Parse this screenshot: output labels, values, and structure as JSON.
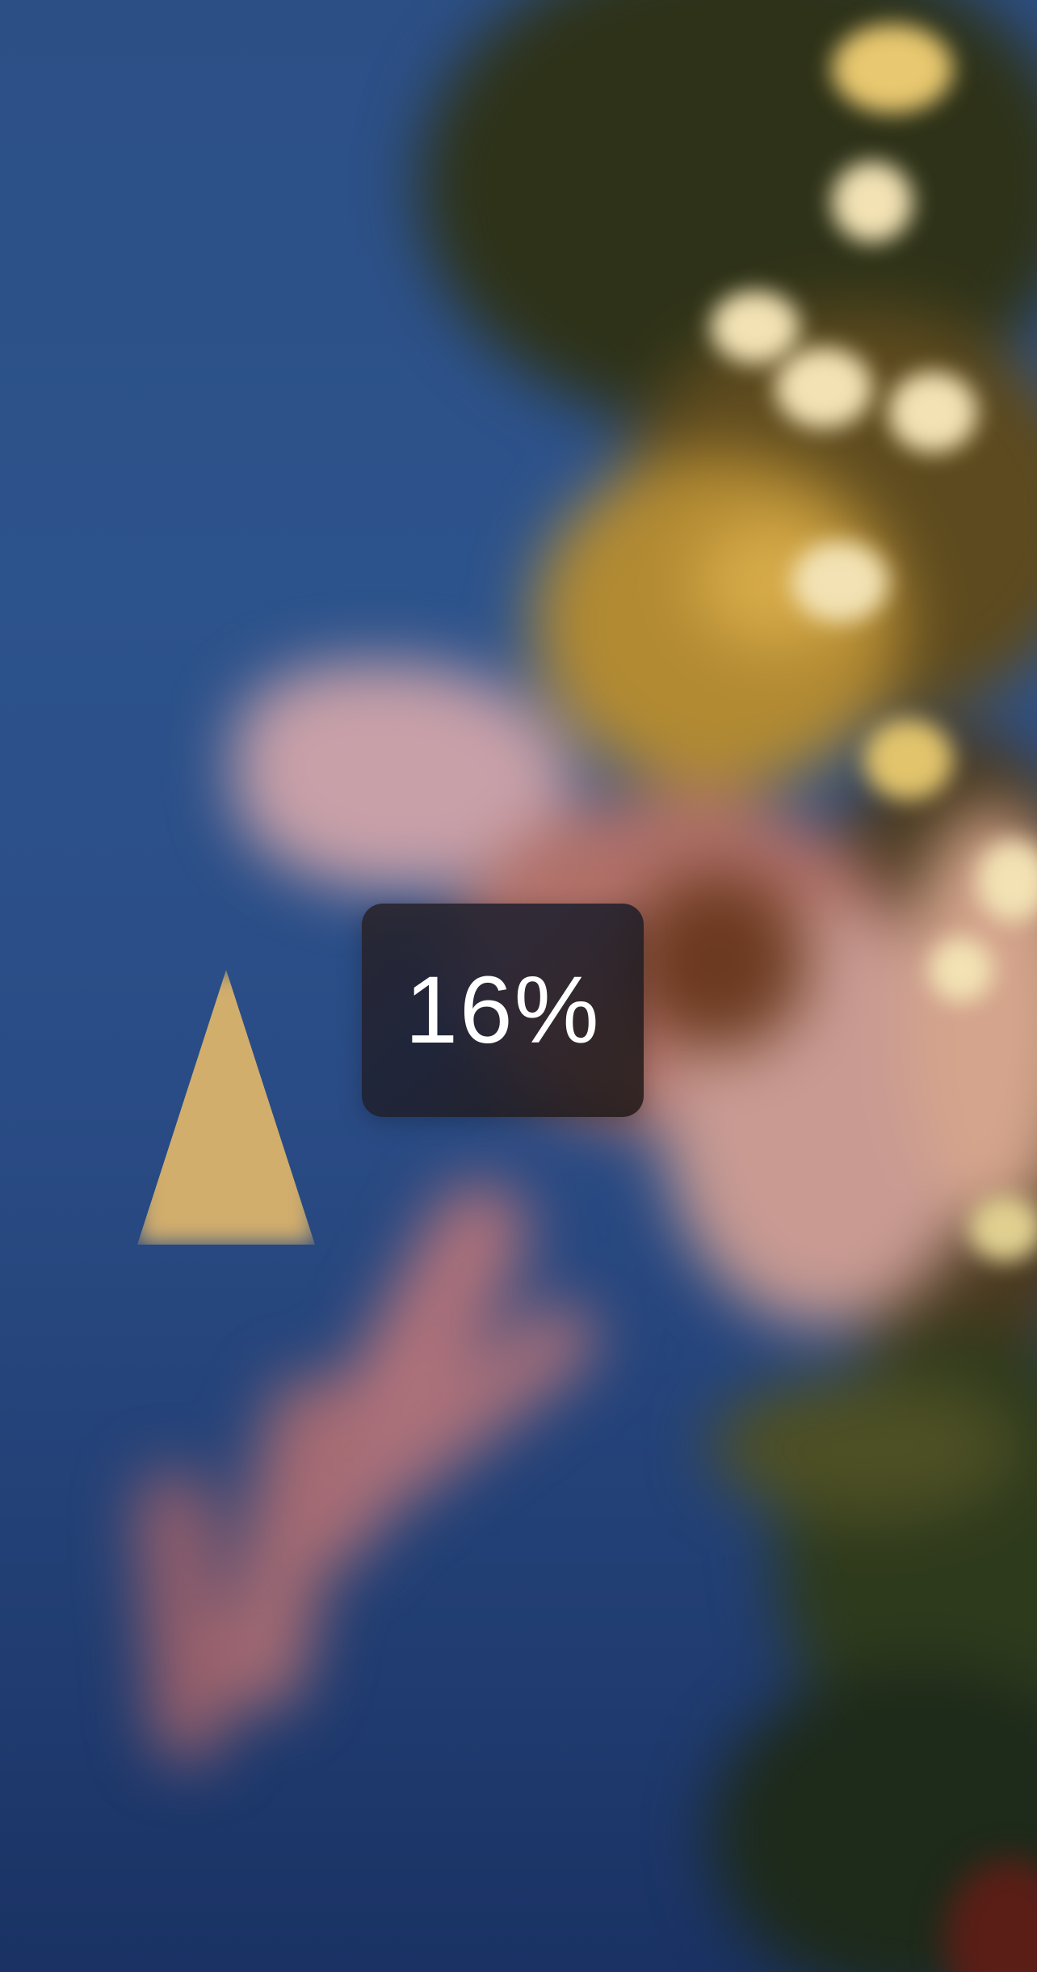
{
  "wallpaper": {
    "description_icon": "blurred-festive-wallpaper",
    "colors": {
      "sky": "#2c4f86",
      "foliage": "#2e3218",
      "gold": "#b28a32",
      "pink": "#c8a0a8"
    }
  },
  "hud": {
    "value": "16%",
    "level": 0.16
  }
}
